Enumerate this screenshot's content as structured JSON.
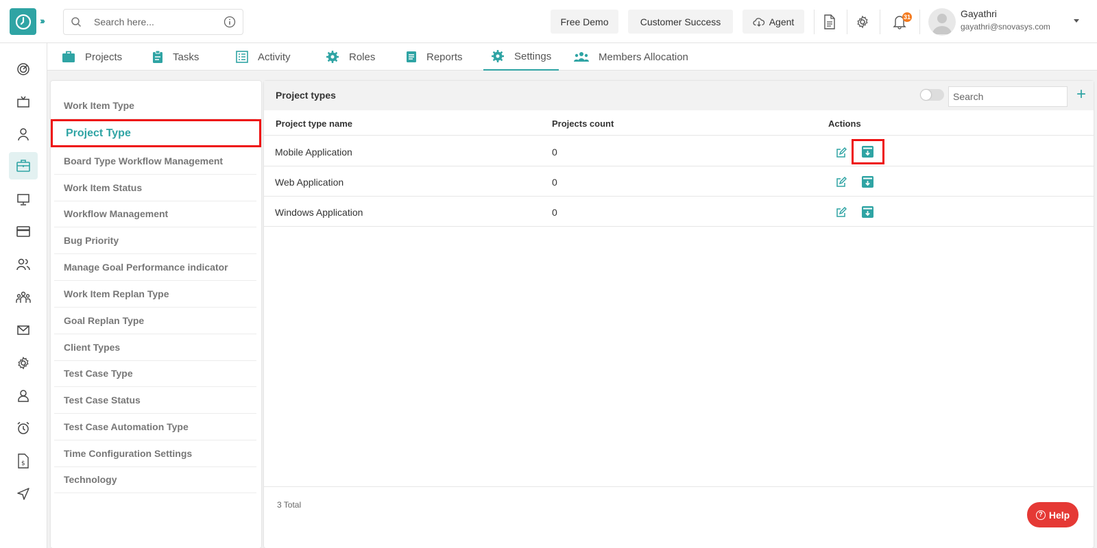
{
  "header": {
    "search_placeholder": "Search here...",
    "buttons": {
      "free_demo": "Free Demo",
      "customer_success": "Customer Success",
      "agent": "Agent"
    },
    "notification_count": "31",
    "user": {
      "name": "Gayathri",
      "email": "gayathri@snovasys.com"
    }
  },
  "tabs": [
    {
      "label": "Projects",
      "icon": "briefcase-icon"
    },
    {
      "label": "Tasks",
      "icon": "clipboard-icon"
    },
    {
      "label": "Activity",
      "icon": "list-icon"
    },
    {
      "label": "Roles",
      "icon": "gear-icon"
    },
    {
      "label": "Reports",
      "icon": "report-icon"
    },
    {
      "label": "Settings",
      "icon": "gear-icon",
      "active": true
    },
    {
      "label": "Members Allocation",
      "icon": "people-icon"
    }
  ],
  "settings_menu": [
    "Work Item Type",
    "Project Type",
    "Board Type Workflow Management",
    "Work Item Status",
    "Workflow Management",
    "Bug Priority",
    "Manage Goal Performance indicator",
    "Work Item Replan Type",
    "Goal Replan Type",
    "Client Types",
    "Test Case Type",
    "Test Case Status",
    "Test Case Automation Type",
    "Time Configuration Settings",
    "Technology"
  ],
  "main": {
    "title": "Project types",
    "search_placeholder": "Search",
    "columns": {
      "name": "Project type name",
      "count": "Projects count",
      "actions": "Actions"
    },
    "rows": [
      {
        "name": "Mobile Application",
        "count": "0"
      },
      {
        "name": "Web Application",
        "count": "0"
      },
      {
        "name": "Windows Application",
        "count": "0"
      }
    ],
    "total": "3 Total"
  },
  "help_label": "Help",
  "colors": {
    "accent": "#2fa4a4",
    "highlight": "#ee1111",
    "help": "#e53935"
  }
}
